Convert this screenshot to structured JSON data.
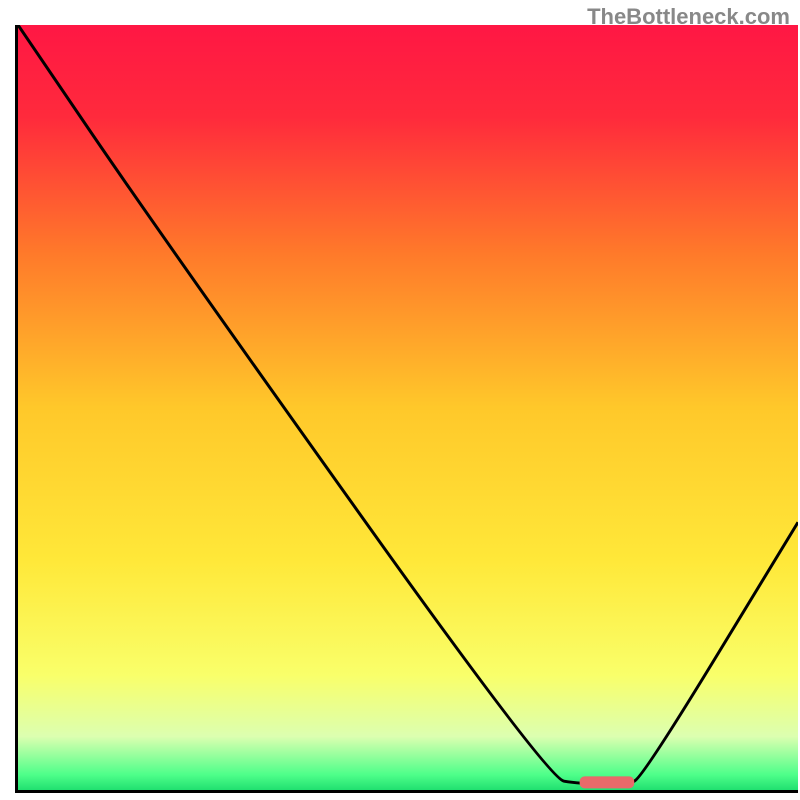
{
  "watermark": "TheBottleneck.com",
  "chart_data": {
    "type": "line",
    "title": "",
    "xlabel": "",
    "ylabel": "",
    "xlim": [
      0,
      100
    ],
    "ylim": [
      0,
      100
    ],
    "background": {
      "type": "vertical_gradient",
      "stops": [
        {
          "pos": 0,
          "color": "#ff1744"
        },
        {
          "pos": 0.12,
          "color": "#ff2a3c"
        },
        {
          "pos": 0.3,
          "color": "#ff7a2a"
        },
        {
          "pos": 0.5,
          "color": "#ffc82a"
        },
        {
          "pos": 0.7,
          "color": "#ffe839"
        },
        {
          "pos": 0.85,
          "color": "#f9ff6a"
        },
        {
          "pos": 0.93,
          "color": "#dcffb0"
        },
        {
          "pos": 0.98,
          "color": "#4eff8a"
        },
        {
          "pos": 1.0,
          "color": "#20e070"
        }
      ]
    },
    "series": [
      {
        "name": "bottleneck_curve",
        "x": [
          0,
          18,
          68,
          72,
          78,
          80,
          100
        ],
        "y": [
          100,
          73,
          1.5,
          0.8,
          0.8,
          1.5,
          35
        ]
      }
    ],
    "marker": {
      "name": "optimal_range",
      "shape": "rounded_bar",
      "color": "#e86a6a",
      "x_start": 72,
      "x_end": 79,
      "y": 1.0
    },
    "grid": false,
    "legend": false
  }
}
